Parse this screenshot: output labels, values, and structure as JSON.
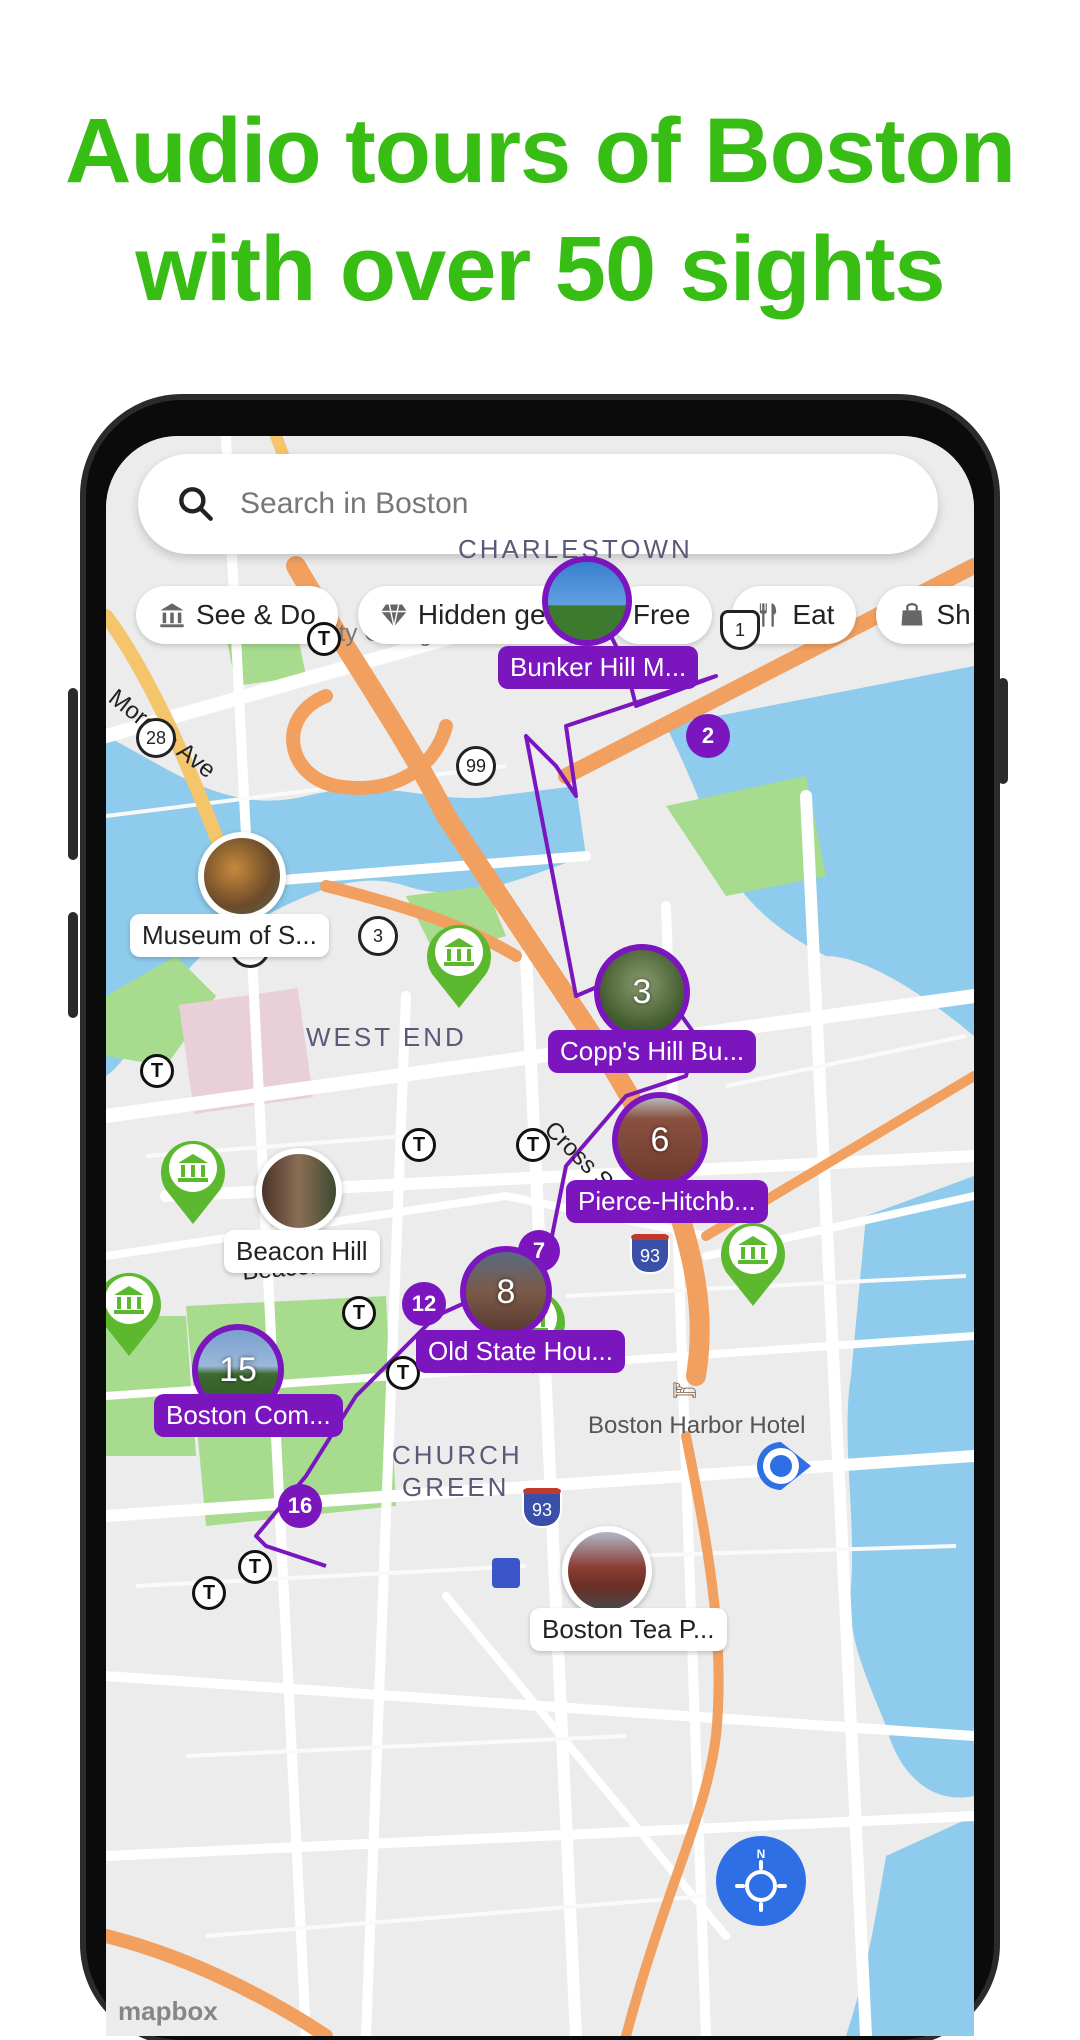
{
  "headline": {
    "line1": "Audio tours of Boston",
    "line2": "with over 50 sights",
    "color": "#37bd13"
  },
  "search": {
    "placeholder": "Search in Boston",
    "icon": "search-icon"
  },
  "chips": [
    {
      "label": "See & Do",
      "icon": "museum-icon"
    },
    {
      "label": "Hidden gem",
      "icon": "diamond-icon"
    },
    {
      "label": "Free",
      "icon": ""
    },
    {
      "label": "Eat",
      "icon": "fork-knife-icon"
    },
    {
      "label": "Sh",
      "icon": "shopping-bag-icon"
    }
  ],
  "tour_stops": [
    {
      "number": "",
      "label": "Bunker Hill M..."
    },
    {
      "number": "2",
      "label": ""
    },
    {
      "number": "3",
      "label": "Copp's Hill Bu..."
    },
    {
      "number": "6",
      "label": "Pierce-Hitchb..."
    },
    {
      "number": "7",
      "label": ""
    },
    {
      "number": "8",
      "label": "Old State Hou..."
    },
    {
      "number": "12",
      "label": ""
    },
    {
      "number": "15",
      "label": "Boston Com..."
    },
    {
      "number": "16",
      "label": ""
    }
  ],
  "sights": [
    {
      "label": "Museum of S..."
    },
    {
      "label": "Beacon Hill"
    },
    {
      "label": "Boston Tea P..."
    }
  ],
  "map_labels": {
    "charlestown": "CHARLESTOWN",
    "community_college": "Community College",
    "morgan_ave": "Morgan Ave",
    "west_end": "WEST END",
    "beacon_st": "Beacon St",
    "church_green_1": "CHURCH",
    "church_green_2": "GREEN",
    "cross_st": "Cross S",
    "boston_harbor_hotel": "Boston Harbor Hotel",
    "route_28": "28",
    "route_28b": "28",
    "route_99": "99",
    "route_3": "3",
    "route_1": "1",
    "route_93": "93",
    "route_93b": "93",
    "t_stop": "T",
    "attribution": "mapbox"
  },
  "colors": {
    "tour_purple": "#7b16bf",
    "sight_green": "#5cb82e",
    "water": "#8ecbec",
    "park": "#a7dc8f",
    "highway": "#f2a05f",
    "location_blue": "#2f6fe6"
  }
}
